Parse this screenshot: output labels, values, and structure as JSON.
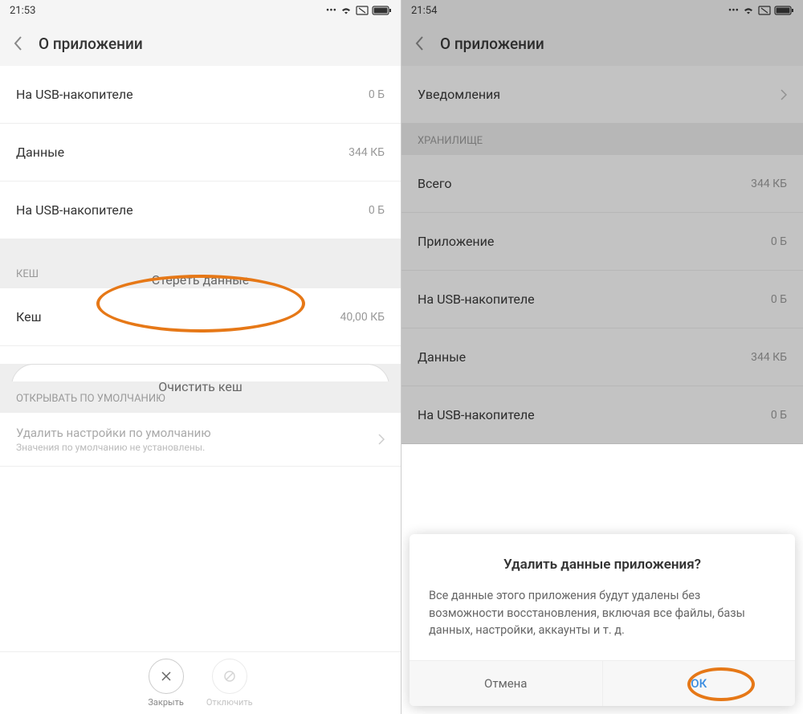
{
  "left": {
    "time": "21:53",
    "header": "О приложении",
    "rows": {
      "usb1": {
        "label": "На USB-накопителе",
        "value": "0 Б"
      },
      "data": {
        "label": "Данные",
        "value": "344 КБ"
      },
      "usb2": {
        "label": "На USB-накопителе",
        "value": "0 Б"
      },
      "cache": {
        "label": "Кеш",
        "value": "40,00 КБ"
      }
    },
    "buttons": {
      "clear_data": "Стереть данные",
      "clear_cache": "Очистить кеш"
    },
    "sections": {
      "cache": "КЕШ",
      "defaults": "ОТКРЫВАТЬ ПО УМОЛЧАНИЮ"
    },
    "defaults": {
      "title": "Удалить настройки по умолчанию",
      "sub": "Значения по умолчанию не установлены."
    },
    "bottom": {
      "close": "Закрыть",
      "disable": "Отключить"
    }
  },
  "right": {
    "time": "21:54",
    "header": "О приложении",
    "rows": {
      "notif": {
        "label": "Уведомления"
      },
      "total": {
        "label": "Всего",
        "value": "344 КБ"
      },
      "app": {
        "label": "Приложение",
        "value": "0 Б"
      },
      "usb": {
        "label": "На USB-накопителе",
        "value": "0 Б"
      },
      "data": {
        "label": "Данные",
        "value": "344 КБ"
      },
      "usb2": {
        "label": "На USB-накопителе",
        "value": "0 Б"
      }
    },
    "sections": {
      "storage": "ХРАНИЛИЩЕ"
    },
    "dialog": {
      "title": "Удалить данные приложения?",
      "message": "Все данные этого приложения будут удалены без возможности восстановления, включая все файлы, базы данных, настройки, аккаунты и т. д.",
      "cancel": "Отмена",
      "ok": "ОК"
    }
  }
}
